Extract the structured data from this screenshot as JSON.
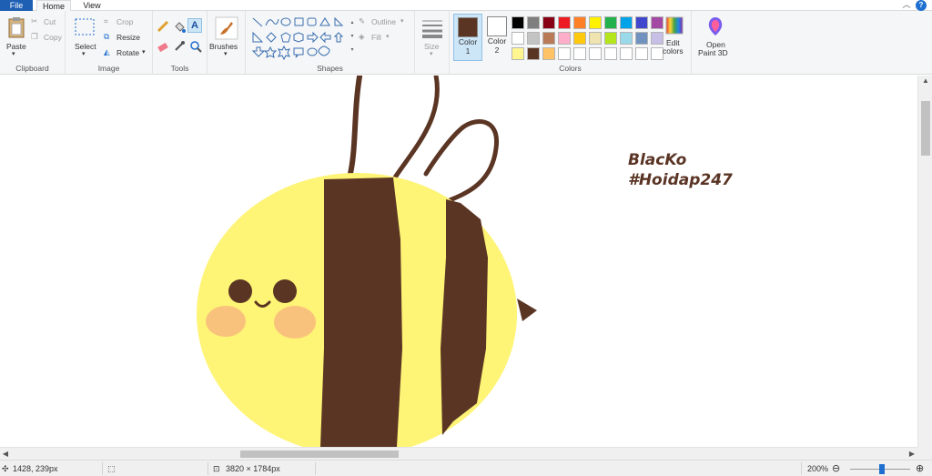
{
  "menu": {
    "file": "File",
    "home": "Home",
    "view": "View",
    "collapse_glyph": "︿",
    "help_glyph": "?"
  },
  "clipboard": {
    "paste": "Paste",
    "cut": "Cut",
    "copy": "Copy",
    "group": "Clipboard"
  },
  "image": {
    "select": "Select",
    "crop": "Crop",
    "resize": "Resize",
    "rotate": "Rotate",
    "group": "Image"
  },
  "tools": {
    "group": "Tools",
    "text_glyph": "A"
  },
  "brushes": {
    "label": "Brushes"
  },
  "shapes": {
    "outline": "Outline",
    "fill": "Fill",
    "group": "Shapes"
  },
  "size": {
    "label": "Size"
  },
  "colors": {
    "color1_label": "Color",
    "color1_num": "1",
    "color2_label": "Color",
    "color2_num": "2",
    "color1_value": "#5b3524",
    "color2_value": "#ffffff",
    "edit_label": "Edit",
    "edit_label2": "colors",
    "group": "Colors",
    "palette_row1": [
      "#000000",
      "#7f7f7f",
      "#880015",
      "#ed1c24",
      "#ff7f27",
      "#fff200",
      "#22b14c",
      "#00a2e8",
      "#3f48cc",
      "#a349a4"
    ],
    "palette_row2": [
      "#ffffff",
      "#c3c3c3",
      "#b97a57",
      "#ffaec9",
      "#ffc90e",
      "#efe4b0",
      "#b5e61d",
      "#99d9ea",
      "#7092be",
      "#c8bfe7"
    ],
    "palette_row3": [
      "#fff68f",
      "#5b3524",
      "#ffc266",
      "#ffffff",
      "#ffffff",
      "#ffffff",
      "#ffffff",
      "#ffffff",
      "#ffffff",
      "#ffffff"
    ]
  },
  "paint3d": {
    "label1": "Open",
    "label2": "Paint 3D"
  },
  "canvas": {
    "signature_line1": "BlacKo",
    "signature_line2": "#Hoidap247",
    "bee_body_color": "#fef476",
    "stripe_color": "#5b3524",
    "cheek_color": "#f9c27c"
  },
  "status": {
    "cursor_pos": "1428, 239px",
    "image_size": "3820 × 1784px",
    "zoom": "200%",
    "zoom_level": 0.5
  }
}
